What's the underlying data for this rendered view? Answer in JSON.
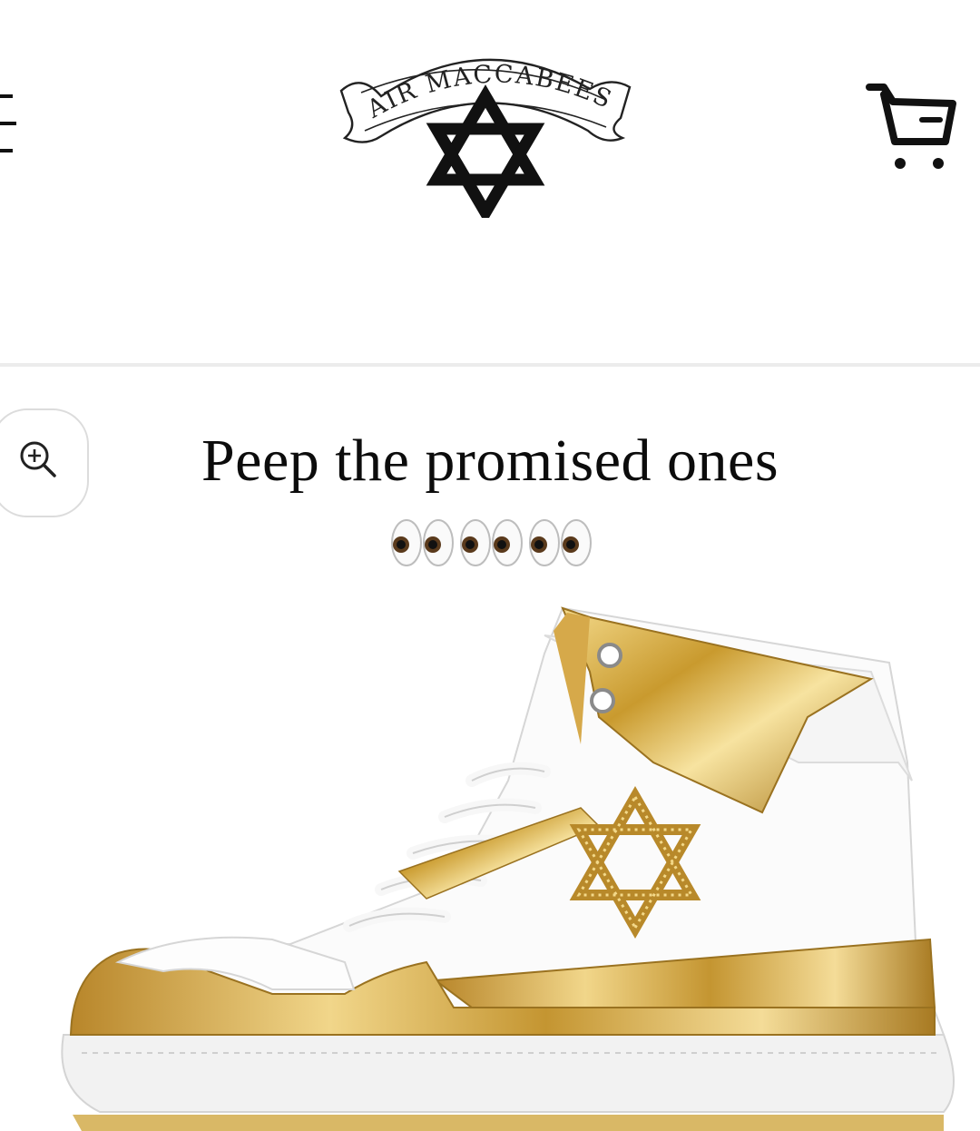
{
  "header": {
    "logo_text": "AIR MACCABEES",
    "menu_icon": "hamburger-menu-icon",
    "cart_icon": "shopping-cart-icon"
  },
  "zoom_icon": "zoom-in-icon",
  "caption": {
    "text": "Peep the promised ones",
    "emoji": "👀👀👀"
  },
  "product": {
    "image": "gold-white-high-top-sneaker-with-star-of-david",
    "colors": {
      "gold": "#c9a23a",
      "white": "#ffffff"
    }
  }
}
